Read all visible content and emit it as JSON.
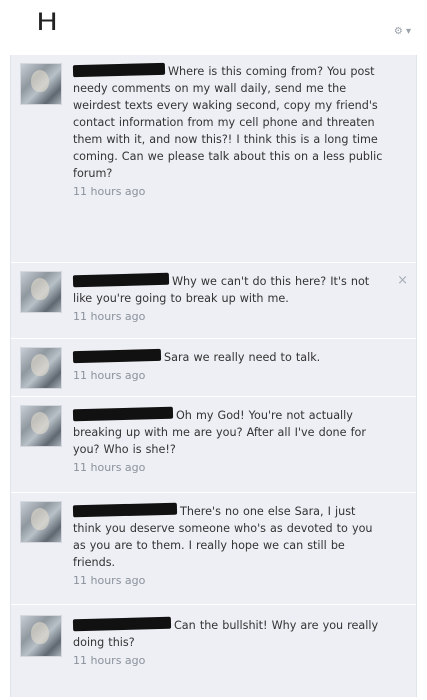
{
  "header": {
    "corner_mark": "H",
    "gear_menu": "⚙ ▾"
  },
  "comments": [
    {
      "text": "Where is this coming from? You post needy comments on my wall daily, send me the weirdest texts every waking second, copy my friend's contact information from my cell phone and threaten them with it, and now this?! I think this is a long time coming. Can we please talk about this on a less public forum?",
      "time": "11 hours ago"
    },
    {
      "text": "Why we can't do this here? It's not like you're going to break up with me.",
      "time": "11 hours ago",
      "remove": "×"
    },
    {
      "text": "Sara we really need to talk.",
      "time": "11 hours ago"
    },
    {
      "text": "Oh my God! You're not actually breaking up with me are you? After all I've done for you? Who is she!?",
      "time": "11 hours ago"
    },
    {
      "text": "There's no one else Sara, I just think you deserve someone who's as devoted to you as you are to them. I really hope we can still be friends.",
      "time": "11 hours ago"
    },
    {
      "text": "Can the bullshit! Why are you really doing this?",
      "time": "11 hours ago"
    }
  ],
  "colors": {
    "feed_background": "#edeff4",
    "text": "#333333",
    "timestamp": "#8b929c",
    "redaction": "#111111"
  }
}
